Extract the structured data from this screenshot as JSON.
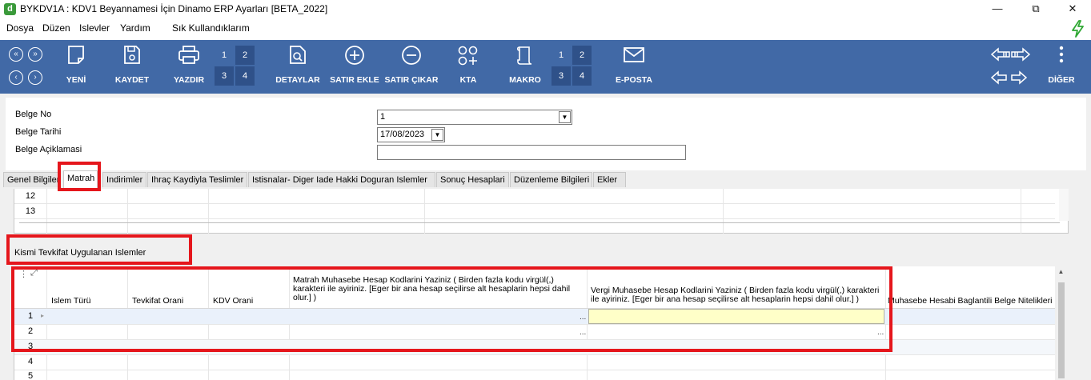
{
  "window": {
    "app_icon_letter": "d",
    "title": "BYKDV1A : KDV1 Beyannamesi İçin Dinamo ERP Ayarları [BETA_2022]",
    "minimize": "—",
    "restore": "⧉",
    "close": "✕"
  },
  "menu": {
    "items": [
      "Dosya",
      "Düzen",
      "Islevler",
      "Yardım",
      "Sık Kullandıklarım"
    ]
  },
  "toolbar": {
    "nav_circles": [
      "«",
      "»",
      "‹",
      "›"
    ],
    "buttons": {
      "new": "YENİ",
      "save": "KAYDET",
      "print": "YAZDIR",
      "details": "DETAYLAR",
      "add_row": "SATIR EKLE",
      "remove_row": "SATIR ÇIKAR",
      "kta": "KTA",
      "macro": "MAKRO",
      "email": "E-POSTA",
      "more": "DİĞER"
    },
    "print_numbers": [
      "1",
      "2",
      "3",
      "4"
    ],
    "macro_numbers": [
      "1",
      "2",
      "3",
      "4"
    ],
    "background_color": "#4169a6"
  },
  "form": {
    "belge_no_label": "Belge No",
    "belge_no_value": "1",
    "belge_tarihi_label": "Belge Tarihi",
    "belge_tarihi_value": "17/08/2023",
    "belge_aciklamasi_label": "Belge Açiklamasi",
    "belge_aciklamasi_value": ""
  },
  "tabs": [
    "Genel Bilgiler",
    "Matrah",
    "Indirimler",
    "Ihraç Kaydiyla Teslimler",
    "Istisnalar- Diger Iade Hakki Doguran Islemler",
    "Sonuç Hesaplari",
    "Düzenleme Bilgileri",
    "Ekler"
  ],
  "active_tab": "Matrah",
  "upper_grid": {
    "row_numbers": [
      "12",
      "13"
    ]
  },
  "section": {
    "title": "Kismi Tevkifat Uygulanan Islemler"
  },
  "lower_grid": {
    "columns": [
      "Islem Türü",
      "Tevkifat Orani",
      "KDV Orani",
      "Matrah Muhasebe Hesap Kodlarini Yaziniz ( Birden fazla kodu virgül(,) karakteri ile ayiriniz.  [Eger bir ana hesap seçilirse alt hesaplarin hepsi dahil olur.] )",
      "Vergi Muhasebe Hesap Kodlarini Yaziniz ( Birden fazla kodu virgül(,) karakteri ile ayiriniz.  [Eger bir ana hesap seçilirse alt hesaplarin hepsi dahil olur.] )",
      "Muhasebe Hesabi Baglantili Belge Nitelikleri"
    ],
    "row_numbers": [
      "1",
      "2",
      "3",
      "4",
      "5"
    ],
    "ellipsis": "...",
    "grid_corner_icon": "⋮",
    "expand_icon": "⤢"
  },
  "highlight_color": "#e5161c"
}
